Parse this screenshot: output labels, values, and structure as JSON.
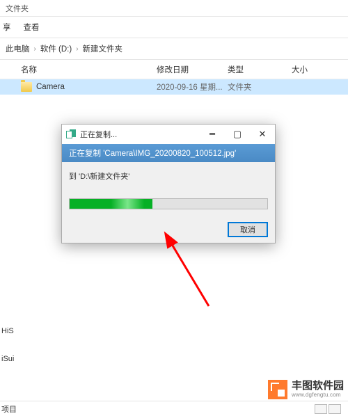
{
  "tab_label": "文件夹",
  "ribbon": {
    "share": "享",
    "view": "查看"
  },
  "breadcrumb": {
    "root": "此电脑",
    "drive": "软件 (D:)",
    "folder": "新建文件夹"
  },
  "columns": {
    "name": "名称",
    "date": "修改日期",
    "type": "类型",
    "size": "大小"
  },
  "rows": [
    {
      "name": "Camera",
      "date": "2020-09-16 星期...",
      "type": "文件夹",
      "size": ""
    }
  ],
  "sidebar": {
    "item1": "HiS",
    "item2": "iSui"
  },
  "status": {
    "text": "项目"
  },
  "dialog": {
    "title": "正在复制...",
    "header": "正在复制 'Camera\\IMG_20200820_100512.jpg'",
    "dest": "到 'D:\\新建文件夹'",
    "cancel": "取消",
    "progress_pct": 42
  },
  "watermark": {
    "main": "丰图软件园",
    "sub": "www.dgfengtu.com"
  }
}
